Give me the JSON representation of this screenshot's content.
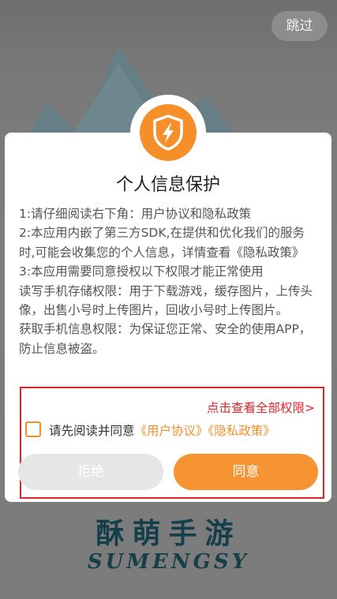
{
  "skip_button": {
    "label": "跳过"
  },
  "dialog": {
    "title": "个人信息保护",
    "paragraphs": [
      "1:请仔细阅读右下角：用户协议和隐私政策",
      "2:本应用内嵌了第三方SDK,在提供和优化我们的服务时,可能会收集您的个人信息，详情查看《隐私政策》",
      "3:本应用需要同意授权以下权限才能正常使用",
      "读写手机存储权限：用于下载游戏，缓存图片，上传头像，出售小号时上传图片，回收小号时上传图片。",
      "获取手机信息权限：为保证您正常、安全的使用APP，防止信息被盗。"
    ],
    "view_all_link": "点击查看全部权限>",
    "agree_prefix": "请先阅读并同意",
    "user_agreement_link": "《用户协议》",
    "privacy_policy_link": "《隐私政策》",
    "refuse_label": "拒绝",
    "agree_label": "同意"
  },
  "brand": {
    "chinese": "酥萌手游",
    "english": "SUMENGSY"
  },
  "colors": {
    "accent_orange": "#f69333",
    "highlight_red": "#e0242c",
    "overlay": "#7a7a7a"
  }
}
